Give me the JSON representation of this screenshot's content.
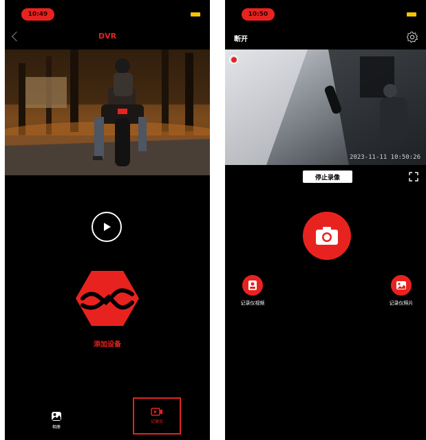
{
  "left_screen": {
    "status": {
      "time": "10:49"
    },
    "header": {
      "title": "DVR"
    },
    "add_device": {
      "label": "添加设备"
    },
    "tabs": [
      {
        "label": "相册"
      },
      {
        "label": "记录仪"
      }
    ]
  },
  "right_screen": {
    "status": {
      "time": "10:50"
    },
    "header": {
      "status_text": "断开"
    },
    "video": {
      "timestamp": "2023-11-11 10:50:26"
    },
    "controls": {
      "stop_recording_label": "停止录像"
    },
    "actions": [
      {
        "label": "记录仪视频",
        "icon": "video-file-icon"
      },
      {
        "label": "记录仪照片",
        "icon": "photo-file-icon"
      }
    ]
  },
  "colors": {
    "accent": "#e8231f",
    "battery": "#f5c400",
    "background": "#000000"
  }
}
